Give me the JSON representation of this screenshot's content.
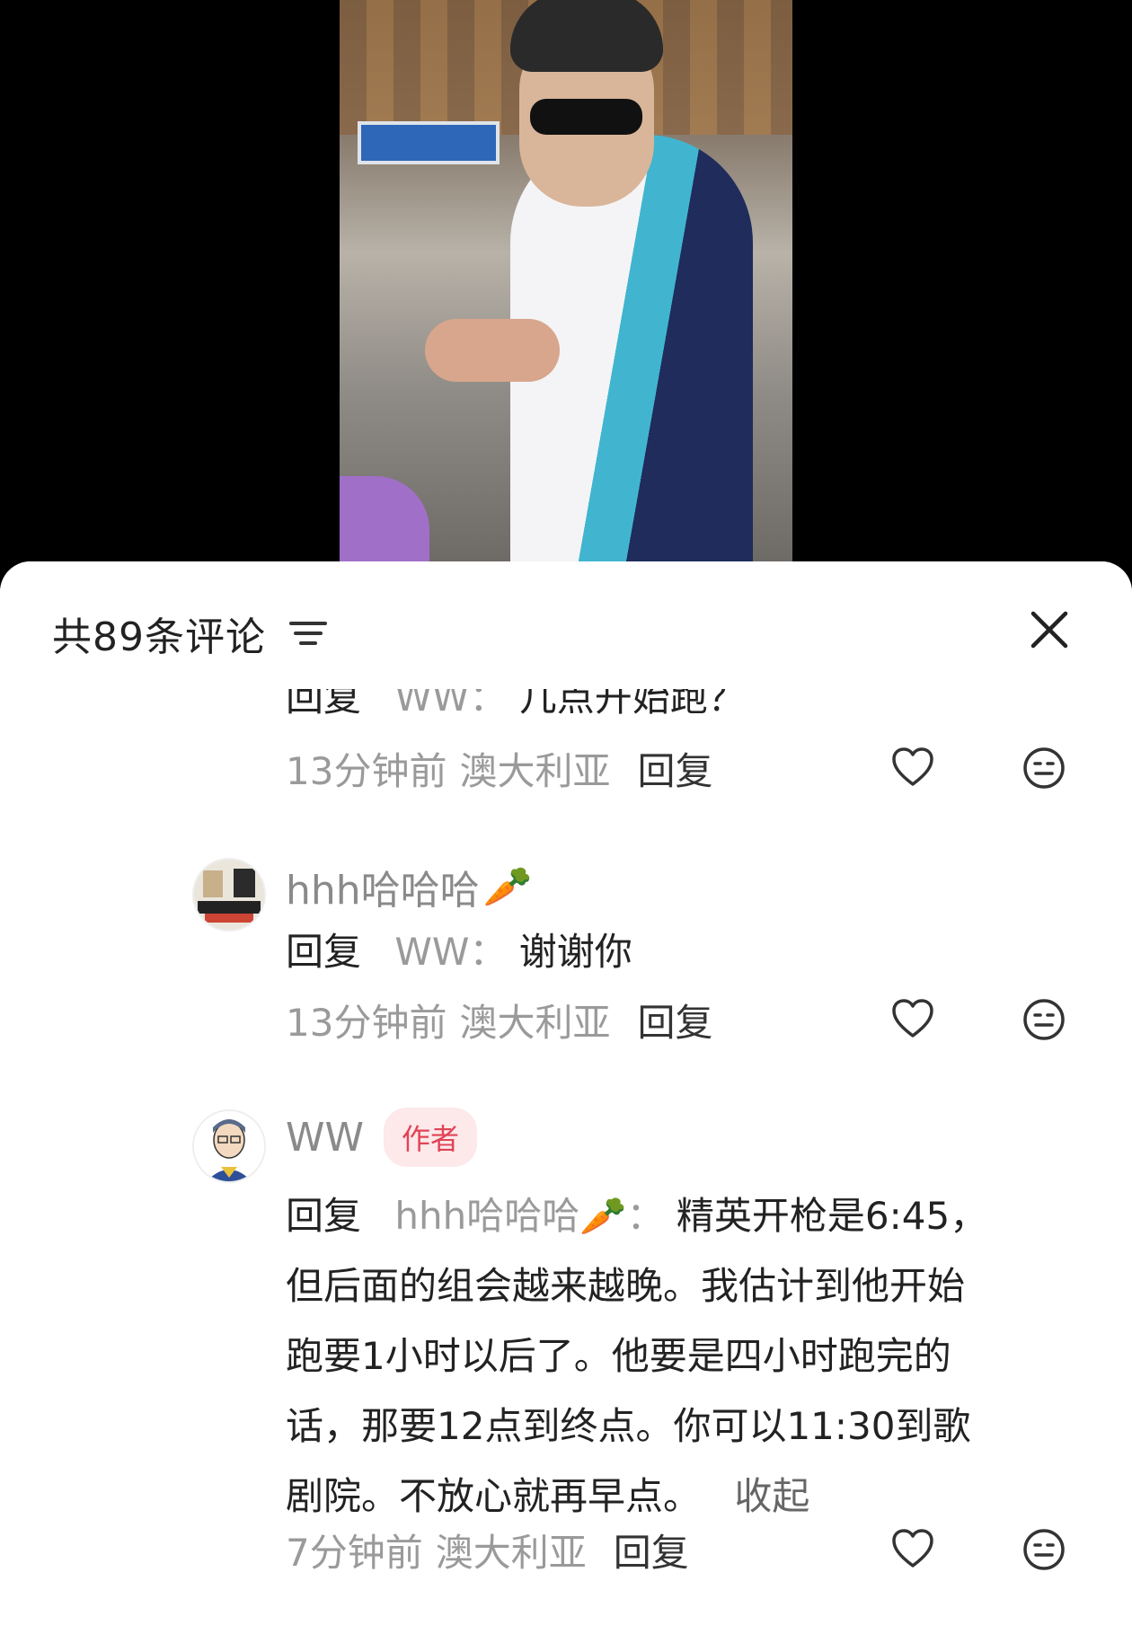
{
  "header": {
    "comment_count_label": "共89条评论"
  },
  "comments": [
    {
      "reply_prefix": "回复",
      "mention": "WW：",
      "text": "几点开始跑？",
      "time": "13分钟前",
      "region": "澳大利亚",
      "reply_label": "回复"
    },
    {
      "username": "hhh哈哈哈",
      "username_suffix": "🥕",
      "reply_prefix": "回复",
      "mention": "WW：",
      "text": "谢谢你",
      "time": "13分钟前",
      "region": "澳大利亚",
      "reply_label": "回复"
    },
    {
      "username": "WW",
      "badge": "作者",
      "reply_prefix": "回复",
      "mention": "hhh哈哈哈🥕：",
      "text_line1": "精英开枪是6:45，",
      "text_line2": "但后面的组会越来越晚。我估计到他开始",
      "text_line3": "跑要1小时以后了。他要是四小时跑完的",
      "text_line4": "话，那要12点到终点。你可以11:30到歌",
      "text_line5": "剧院。不放心就再早点。",
      "collapse_label": "收起",
      "time": "7分钟前",
      "region": "澳大利亚",
      "reply_label": "回复"
    }
  ],
  "colors": {
    "badge_bg": "#fde8ea",
    "badge_text": "#e04455",
    "secondary_text": "#9a9a9a"
  }
}
